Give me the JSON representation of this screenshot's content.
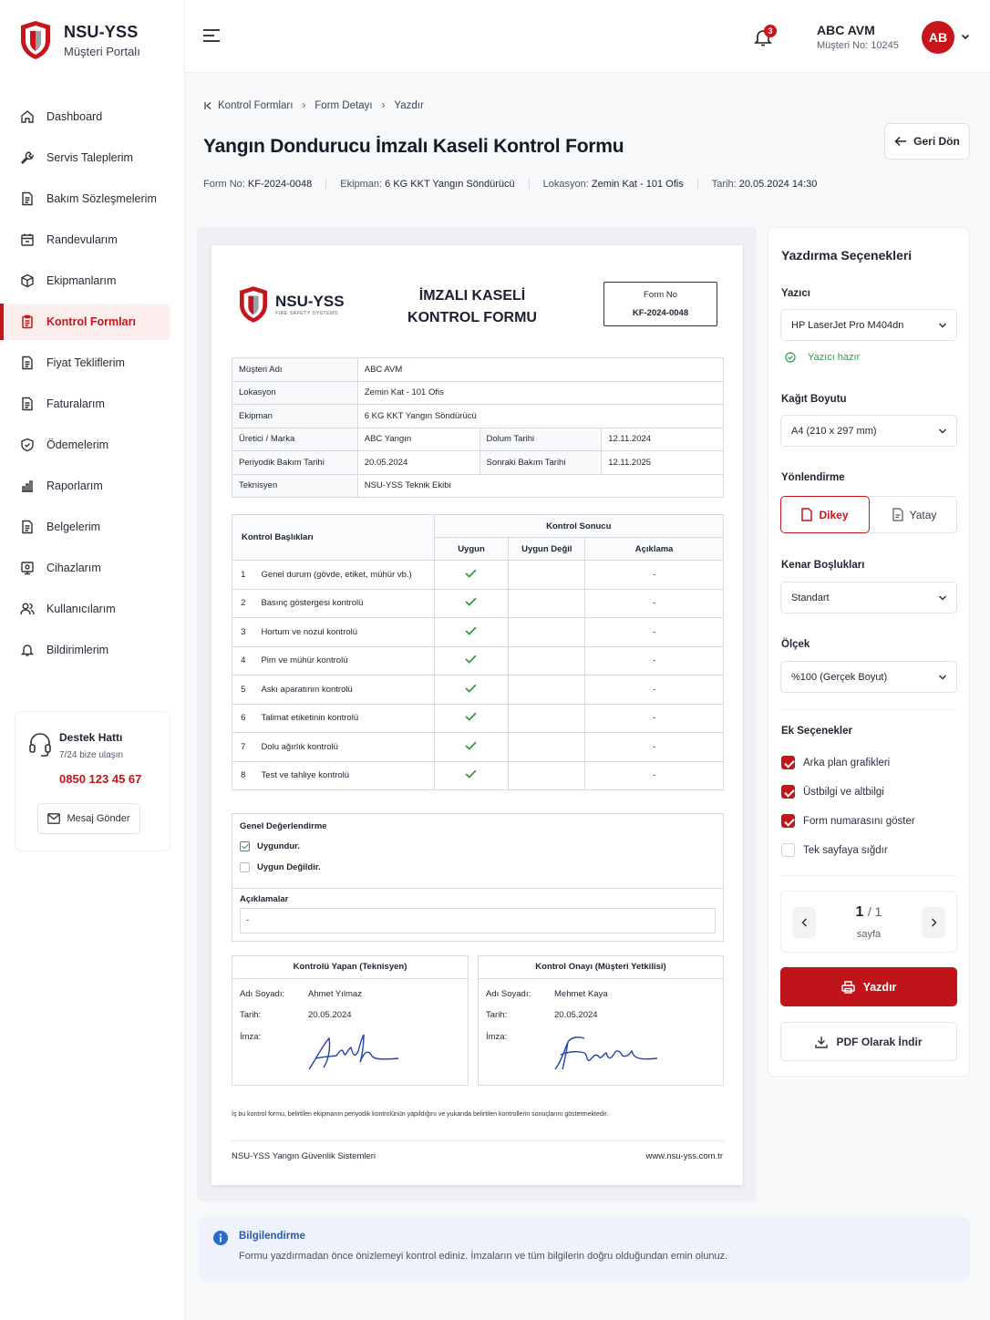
{
  "brand": {
    "name": "NSU-YSS",
    "subtitle": "Müşteri Portalı"
  },
  "sidebar": {
    "items": [
      {
        "label": "Dashboard",
        "icon": "home-icon"
      },
      {
        "label": "Servis Taleplerim",
        "icon": "wrench-icon"
      },
      {
        "label": "Bakım Sözleşmelerim",
        "icon": "document-icon"
      },
      {
        "label": "Randevularım",
        "icon": "calendar-icon"
      },
      {
        "label": "Ekipmanlarım",
        "icon": "cube-icon"
      },
      {
        "label": "Kontrol Formları",
        "icon": "clipboard-icon",
        "active": true
      },
      {
        "label": "Fiyat Tekliflerim",
        "icon": "file-icon"
      },
      {
        "label": "Faturalarım",
        "icon": "invoice-icon"
      },
      {
        "label": "Ödemelerim",
        "icon": "payment-icon"
      },
      {
        "label": "Raporlarım",
        "icon": "bar-chart-icon"
      },
      {
        "label": "Belgelerim",
        "icon": "document-icon"
      },
      {
        "label": "Cihazlarım",
        "icon": "device-icon"
      },
      {
        "label": "Kullanıcılarım",
        "icon": "users-icon"
      },
      {
        "label": "Bildirimlerim",
        "icon": "bell-icon"
      }
    ]
  },
  "support": {
    "title": "Destek Hattı",
    "subtitle": "7/24 bize ulaşın",
    "phone": "0850 123 45 67",
    "button": "Mesaj Gönder"
  },
  "header": {
    "notifications": "3",
    "user_name": "ABC AVM",
    "customer_no": "Müşteri No: 10245",
    "avatar": "AB"
  },
  "breadcrumb": {
    "items": [
      "Kontrol Formları",
      "Form Detayı",
      "Yazdır"
    ]
  },
  "page": {
    "title": "Yangın Dondurucu İmzalı Kaseli Kontrol Formu",
    "back_label": "Geri Dön"
  },
  "meta": [
    {
      "label": "Form No:",
      "value": "KF-2024-0048"
    },
    {
      "label": "Ekipman:",
      "value": "6 KG KKT Yangın Söndürücü"
    },
    {
      "label": "Lokasyon:",
      "value": "Zemin Kat - 101 Ofis"
    },
    {
      "label": "Tarih:",
      "value": "20.05.2024 14:30"
    }
  ],
  "form": {
    "logo_name": "NSU-YSS",
    "logo_sub": "FIRE SAFETY SYSTEMS",
    "title_line1": "İMZALI KASELİ",
    "title_line2": "KONTROL FORMU",
    "form_no_label": "Form No",
    "form_no": "KF-2024-0048",
    "info": {
      "customer_label": "Müşteri Adı",
      "customer": "ABC AVM",
      "location_label": "Lokasyon",
      "location": "Zemin Kat - 101 Ofis",
      "equipment_label": "Ekipman",
      "equipment": "6 KG KKT Yangın Söndürücü",
      "maker_label": "Üretici / Marka",
      "maker": "ABC Yangın",
      "fill_label": "Dolum Tarihi",
      "fill": "12.11.2024",
      "periodic_label": "Periyodik Bakım Tarihi",
      "periodic": "20.05.2024",
      "next_label": "Sonraki Bakım Tarihi",
      "next": "12.11.2025",
      "tech_label": "Teknisyen",
      "tech": "NSU-YSS Teknik Ekibi"
    },
    "checks_header": {
      "title": "Kontrol Başlıkları",
      "result": "Kontrol Sonucu",
      "ok": "Uygun",
      "not_ok": "Uygun Değil",
      "note": "Açıklama"
    },
    "checks": [
      {
        "no": "1",
        "label": "Genel durum (gövde, etiket, mühür vb.)",
        "note": "-"
      },
      {
        "no": "2",
        "label": "Basınç göstergesi kontrolü",
        "note": "-"
      },
      {
        "no": "3",
        "label": "Hortum ve nozul kontrolü",
        "note": "-"
      },
      {
        "no": "4",
        "label": "Pim ve mühür kontrolü",
        "note": "-"
      },
      {
        "no": "5",
        "label": "Askı aparatının kontrolü",
        "note": "-"
      },
      {
        "no": "6",
        "label": "Talimat etiketinin kontrolü",
        "note": "-"
      },
      {
        "no": "7",
        "label": "Dolu ağırlık kontrolü",
        "note": "-"
      },
      {
        "no": "8",
        "label": "Test ve tahliye kontrolü",
        "note": "-"
      }
    ],
    "evaluation": {
      "title": "Genel Değerlendirme",
      "ok": "Uygundur.",
      "not_ok": "Uygun Değildir.",
      "notes_title": "Açıklamalar",
      "notes": "-"
    },
    "sign_tech": {
      "title": "Kontrolü Yapan (Teknisyen)",
      "name_label": "Adı Soyadı:",
      "name": "Ahmet Yılmaz",
      "date_label": "Tarih:",
      "date": "20.05.2024",
      "sign_label": "İmza:"
    },
    "sign_cust": {
      "title": "Kontrol Onayı (Müşteri Yetkilisi)",
      "name_label": "Adı Soyadı:",
      "name": "Mehmet Kaya",
      "date_label": "Tarih:",
      "date": "20.05.2024",
      "sign_label": "İmza:"
    },
    "note": "İş bu kontrol formu, belirtilen ekipmanın periyodik kontrolünün yapıldığını ve yukarıda belirtilen kontrollerin sonuçlarını göstermektedir.",
    "footer_left": "NSU-YSS Yangın Güvenlik Sistemleri",
    "footer_right": "www.nsu-yss.com.tr"
  },
  "print_options": {
    "title": "Yazdırma Seçenekleri",
    "printer_label": "Yazıcı",
    "printer": "HP LaserJet Pro M404dn",
    "printer_status": "Yazıcı hazır",
    "paper_label": "Kağıt Boyutu",
    "paper": "A4 (210 x 297 mm)",
    "orientation_label": "Yönlendirme",
    "portrait": "Dikey",
    "landscape": "Yatay",
    "margins_label": "Kenar Boşlukları",
    "margins": "Standart",
    "scale_label": "Ölçek",
    "scale": "%100 (Gerçek Boyut)",
    "extras_label": "Ek Seçenekler",
    "extras": [
      {
        "label": "Arka plan grafikleri",
        "checked": true
      },
      {
        "label": "Üstbilgi ve altbilgi",
        "checked": true
      },
      {
        "label": "Form numarasını göster",
        "checked": true
      },
      {
        "label": "Tek sayfaya sığdır",
        "checked": false
      }
    ],
    "page_current": "1",
    "page_total": "/ 1",
    "page_label": "sayfa",
    "print_label": "Yazdır",
    "pdf_label": "PDF Olarak İndir"
  },
  "notice": {
    "title": "Bilgilendirme",
    "text": "Formu yazdırmadan önce önizlemeyi kontrol ediniz. İmzaların ve tüm bilgilerin doğru olduğundan emin olunuz."
  },
  "colors": {
    "brand": "#c0141b",
    "active_bg": "#fdeeee",
    "success": "#2e9b45",
    "info": "#2c5aa8"
  }
}
